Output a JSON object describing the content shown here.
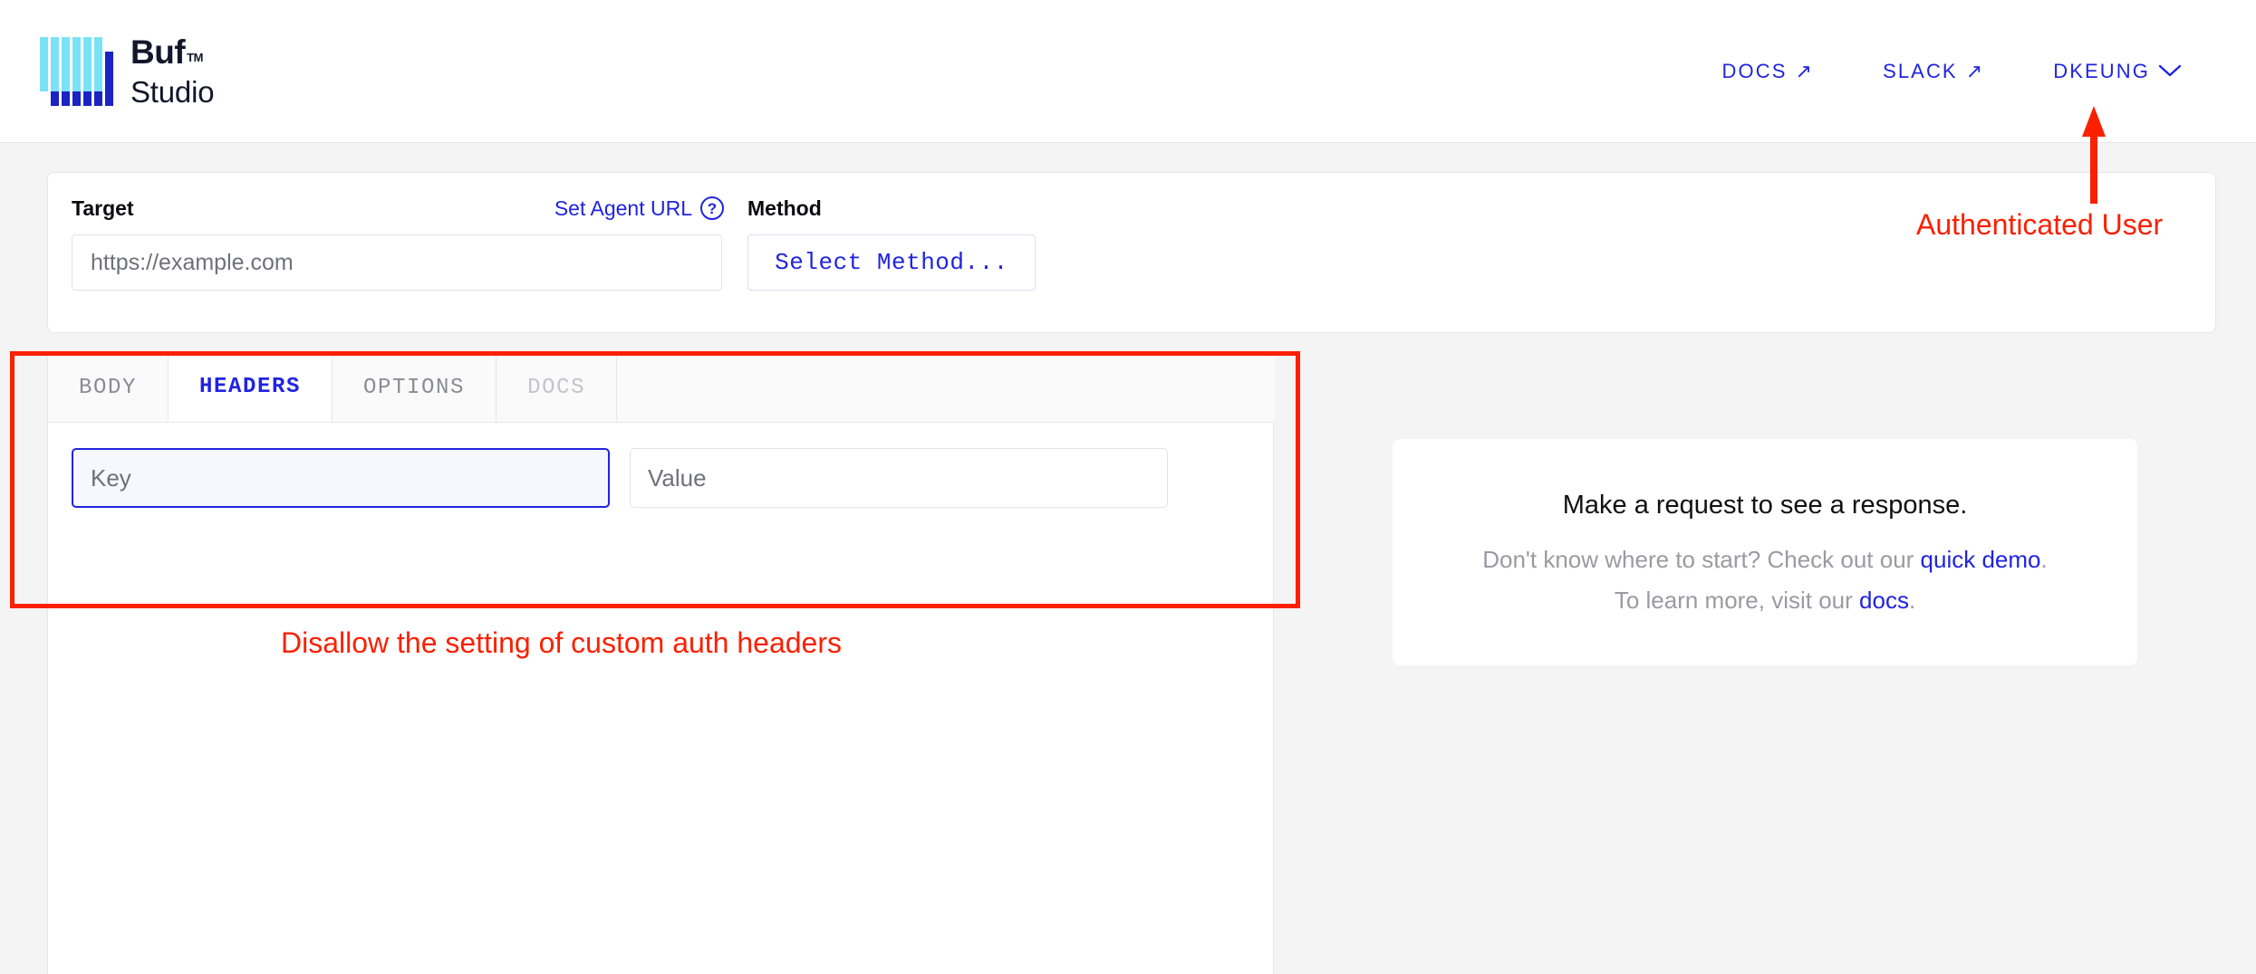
{
  "brand": {
    "name": "Buf",
    "trademark": "TM",
    "product": "Studio",
    "logo_light_color": "#7ae2f7",
    "logo_dark_color": "#1b23c4"
  },
  "header": {
    "nav": [
      {
        "label": "DOCS",
        "icon": "external-link-arrow-icon",
        "glyph": "↗"
      },
      {
        "label": "SLACK",
        "icon": "external-link-arrow-icon",
        "glyph": "↗"
      },
      {
        "label": "DKEUNG",
        "icon": "chevron-down-icon",
        "glyph": "⌄"
      }
    ],
    "link_color": "#2024e0"
  },
  "target_card": {
    "target_label": "Target",
    "agent_url_link": "Set Agent URL",
    "help_icon_glyph": "?",
    "target_placeholder": "https://example.com",
    "target_value": "",
    "method_label": "Method",
    "select_method_label": "Select Method..."
  },
  "request_tabs": [
    {
      "label": "BODY",
      "state": "inactive"
    },
    {
      "label": "HEADERS",
      "state": "active"
    },
    {
      "label": "OPTIONS",
      "state": "inactive"
    },
    {
      "label": "DOCS",
      "state": "disabled"
    }
  ],
  "headers_editor": {
    "key_placeholder": "Key",
    "key_value": "",
    "value_placeholder": "Value",
    "value_value": ""
  },
  "response_panel": {
    "title": "Make a request to see a response.",
    "line1_before": "Don't know where to start? Check out our ",
    "line1_link": "quick demo",
    "line1_after": ".",
    "line2_before": "To learn more, visit our ",
    "line2_link": "docs",
    "line2_after": "."
  },
  "annotations": {
    "color": "#fa2000",
    "authenticated_user": "Authenticated User",
    "disallow_headers": "Disallow the setting of custom auth headers"
  }
}
